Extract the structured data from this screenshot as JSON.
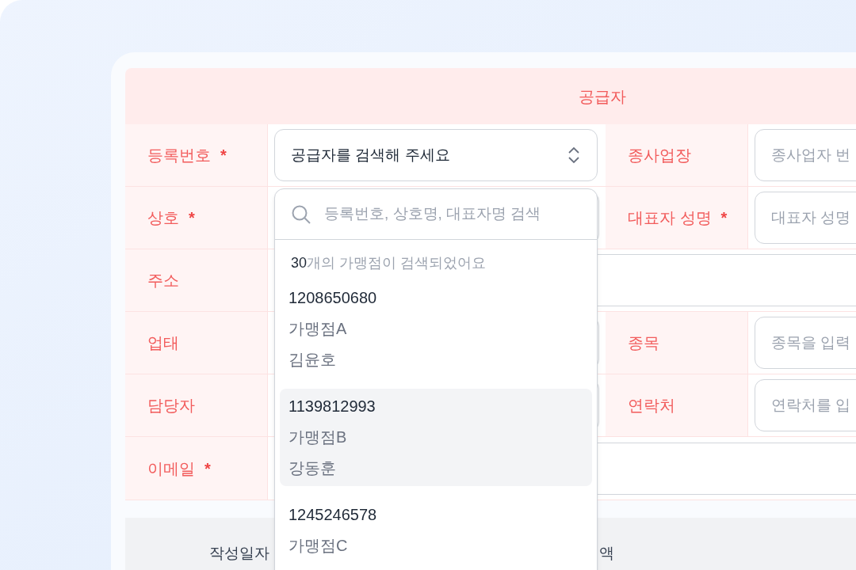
{
  "section": {
    "title": "공급자"
  },
  "rows": [
    {
      "kind": "pair",
      "fields": [
        {
          "label": "등록번호",
          "required": true,
          "kind": "select",
          "value": "공급자를 검색해 주세요"
        },
        {
          "label": "종사업장",
          "required": false,
          "kind": "input",
          "placeholder": "종사업자 번"
        }
      ]
    },
    {
      "kind": "pair",
      "fields": [
        {
          "label": "상호",
          "required": true,
          "kind": "input"
        },
        {
          "label": "대표자 성명",
          "required": true,
          "kind": "input",
          "placeholder": "대표자 성명"
        }
      ]
    },
    {
      "kind": "wide",
      "fields": [
        {
          "label": "주소",
          "required": false,
          "kind": "input"
        }
      ]
    },
    {
      "kind": "pair",
      "fields": [
        {
          "label": "업태",
          "required": false,
          "kind": "input"
        },
        {
          "label": "종목",
          "required": false,
          "kind": "input",
          "placeholder": "종목을 입력"
        }
      ]
    },
    {
      "kind": "pair",
      "fields": [
        {
          "label": "담당자",
          "required": false,
          "kind": "input"
        },
        {
          "label": "연락처",
          "required": false,
          "kind": "input",
          "placeholder": "연락처를 입"
        }
      ]
    },
    {
      "kind": "wide",
      "fields": [
        {
          "label": "이메일",
          "required": true,
          "kind": "input"
        }
      ]
    }
  ],
  "required_mark": "*",
  "footer": {
    "cells": [
      "작성일자",
      "액"
    ]
  },
  "dropdown": {
    "search_placeholder": "등록번호, 상호명, 대표자명 검색",
    "count": "30",
    "count_text": "개의 가맹점이 검색되었어요",
    "items": [
      {
        "number": "1208650680",
        "name": "가맹점A",
        "representative": "김윤호",
        "selected": false
      },
      {
        "number": "1139812993",
        "name": "가맹점B",
        "representative": "강동훈",
        "selected": true
      },
      {
        "number": "1245246578",
        "name": "가맹점C",
        "selected": false
      }
    ]
  }
}
